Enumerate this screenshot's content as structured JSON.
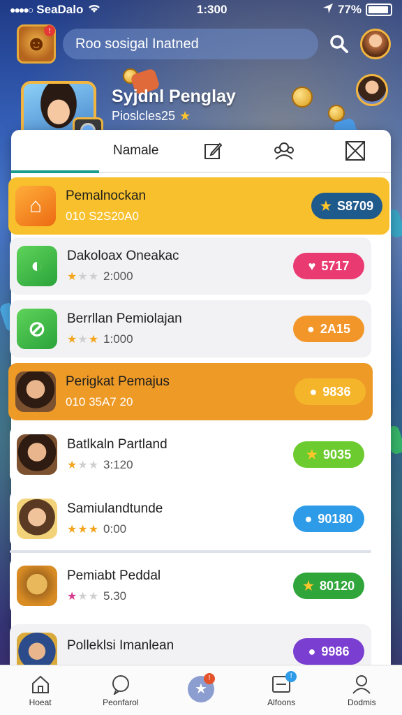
{
  "status_bar": {
    "carrier": "SeaDalo",
    "time": "1:300",
    "battery": "77%"
  },
  "header": {
    "search_text": "Roo sosigal Inatned"
  },
  "profile": {
    "name": "Syjdnl Penglay",
    "subtitle": "Pioslcles25"
  },
  "tabs": {
    "first_label": "Namale"
  },
  "rows": [
    {
      "title": "Pemalnockan",
      "sub": "010 S2S20A0",
      "pill": "S8709",
      "pill_color": "#1f5a8c",
      "pill_icon": "★"
    },
    {
      "title": "Dakoloax Oneakac",
      "sub": "2:000",
      "pill": "5717",
      "pill_color": "#ea3a72",
      "pill_icon": "♥"
    },
    {
      "title": "Berrllan Pemiolajan",
      "sub": "1:000",
      "pill": "2A15",
      "pill_color": "#f2962a",
      "pill_icon": "●"
    },
    {
      "title": "Perigkat Pemajus",
      "sub": "010 35A7 20",
      "pill": "9836",
      "pill_color": "#f5b52a",
      "pill_icon": "●"
    },
    {
      "title": "Batlkaln Partland",
      "sub": "3:120",
      "pill": "9035",
      "pill_color": "#6ccb2e",
      "pill_icon": "★"
    },
    {
      "title": "Samiulandtunde",
      "sub": "0:00",
      "pill": "90180",
      "pill_color": "#2d9be8",
      "pill_icon": "●"
    },
    {
      "title": "Pemiabt Peddal",
      "sub": "5.30",
      "pill": "80120",
      "pill_color": "#2fa53a",
      "pill_icon": "★"
    },
    {
      "title": "Polleklsi Imanlean",
      "sub": "",
      "pill": "9986",
      "pill_color": "#7a3ed1",
      "pill_icon": "●"
    }
  ],
  "nav": {
    "home": "Hoeat",
    "second": "Peonfarol",
    "third": "",
    "fourth": "Alfoons",
    "fifth": "Dodmis"
  },
  "colors": {
    "accent_yellow": "#f7c02c",
    "accent_orange": "#ee9a27",
    "tab_indicator": "#1b9c8a"
  }
}
